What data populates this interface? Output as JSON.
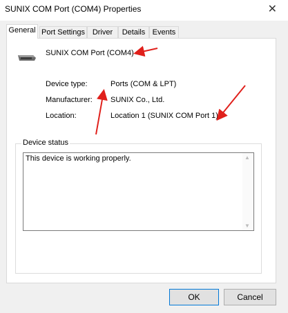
{
  "window": {
    "title": "SUNIX COM Port (COM4) Properties"
  },
  "tabs": [
    {
      "label": "General",
      "active": true
    },
    {
      "label": "Port Settings",
      "active": false
    },
    {
      "label": "Driver",
      "active": false
    },
    {
      "label": "Details",
      "active": false
    },
    {
      "label": "Events",
      "active": false
    }
  ],
  "device": {
    "icon": "serial-port-icon",
    "name": "SUNIX COM Port (COM4)",
    "properties": [
      {
        "label": "Device type:",
        "value": "Ports (COM & LPT)"
      },
      {
        "label": "Manufacturer:",
        "value": "SUNIX Co., Ltd."
      },
      {
        "label": "Location:",
        "value": "Location 1 (SUNIX COM Port 1)"
      }
    ]
  },
  "status": {
    "title": "Device status",
    "text": "This device is working properly."
  },
  "buttons": {
    "ok": "OK",
    "cancel": "Cancel"
  },
  "colors": {
    "annotation": "#e0201b",
    "accent": "#0078d7"
  }
}
